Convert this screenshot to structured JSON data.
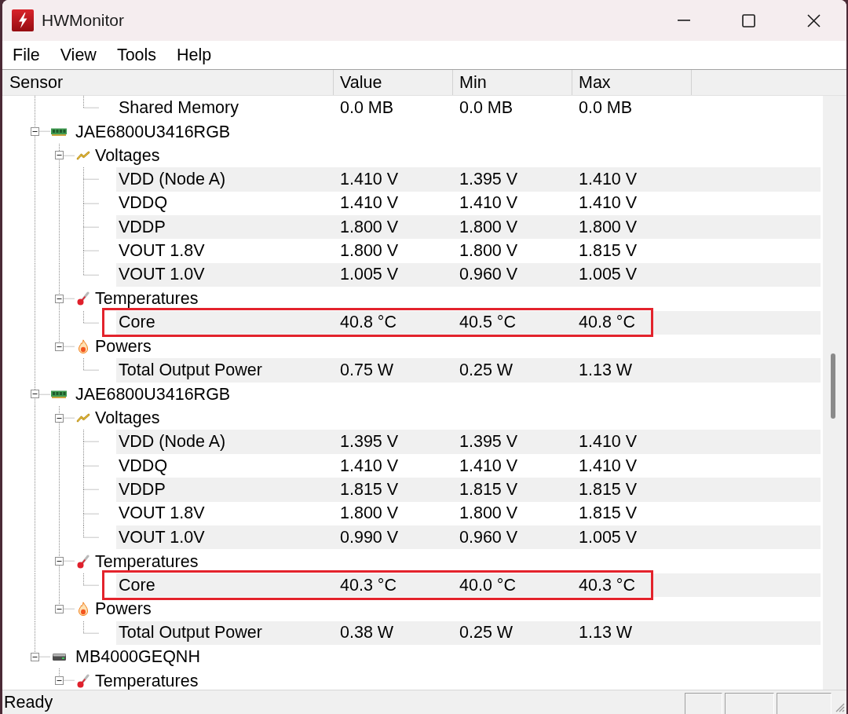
{
  "window": {
    "title": "HWMonitor"
  },
  "menu": [
    {
      "label": "File"
    },
    {
      "label": "View"
    },
    {
      "label": "Tools"
    },
    {
      "label": "Help"
    }
  ],
  "table": {
    "columns": [
      {
        "label": "Sensor"
      },
      {
        "label": "Value"
      },
      {
        "label": "Min"
      },
      {
        "label": "Max"
      }
    ],
    "tree": [
      {
        "children": [
          {
            "children": [
              {
                "label": "Shared Memory",
                "value": "0.0 MB",
                "min": "0.0 MB",
                "max": "0.0 MB",
                "shaded": false,
                "highlighted": false
              }
            ]
          }
        ]
      },
      {
        "kind": "memory",
        "label": "JAE6800U3416RGB",
        "expanded": true,
        "children": [
          {
            "kind": "voltages",
            "label": "Voltages",
            "expanded": true,
            "children": [
              {
                "label": "VDD (Node A)",
                "value": "1.410 V",
                "min": "1.395 V",
                "max": "1.410 V",
                "shaded": true,
                "highlighted": false
              },
              {
                "label": "VDDQ",
                "value": "1.410 V",
                "min": "1.410 V",
                "max": "1.410 V",
                "shaded": false,
                "highlighted": false
              },
              {
                "label": "VDDP",
                "value": "1.800 V",
                "min": "1.800 V",
                "max": "1.800 V",
                "shaded": true,
                "highlighted": false
              },
              {
                "label": "VOUT 1.8V",
                "value": "1.800 V",
                "min": "1.800 V",
                "max": "1.815 V",
                "shaded": false,
                "highlighted": false
              },
              {
                "label": "VOUT 1.0V",
                "value": "1.005 V",
                "min": "0.960 V",
                "max": "1.005 V",
                "shaded": true,
                "highlighted": false
              }
            ]
          },
          {
            "kind": "temperatures",
            "label": "Temperatures",
            "expanded": true,
            "children": [
              {
                "label": "Core",
                "value": "40.8 °C",
                "min": "40.5 °C",
                "max": "40.8 °C",
                "shaded": true,
                "highlighted": true
              }
            ]
          },
          {
            "kind": "powers",
            "label": "Powers",
            "expanded": true,
            "children": [
              {
                "label": "Total Output Power",
                "value": "0.75 W",
                "min": "0.25 W",
                "max": "1.13 W",
                "shaded": true,
                "highlighted": false
              }
            ]
          }
        ]
      },
      {
        "kind": "memory",
        "label": "JAE6800U3416RGB",
        "expanded": true,
        "children": [
          {
            "kind": "voltages",
            "label": "Voltages",
            "expanded": true,
            "children": [
              {
                "label": "VDD (Node A)",
                "value": "1.395 V",
                "min": "1.395 V",
                "max": "1.410 V",
                "shaded": true,
                "highlighted": false
              },
              {
                "label": "VDDQ",
                "value": "1.410 V",
                "min": "1.410 V",
                "max": "1.410 V",
                "shaded": false,
                "highlighted": false
              },
              {
                "label": "VDDP",
                "value": "1.815 V",
                "min": "1.815 V",
                "max": "1.815 V",
                "shaded": true,
                "highlighted": false
              },
              {
                "label": "VOUT 1.8V",
                "value": "1.800 V",
                "min": "1.800 V",
                "max": "1.815 V",
                "shaded": false,
                "highlighted": false
              },
              {
                "label": "VOUT 1.0V",
                "value": "0.990 V",
                "min": "0.960 V",
                "max": "1.005 V",
                "shaded": true,
                "highlighted": false
              }
            ]
          },
          {
            "kind": "temperatures",
            "label": "Temperatures",
            "expanded": true,
            "children": [
              {
                "label": "Core",
                "value": "40.3 °C",
                "min": "40.0 °C",
                "max": "40.3 °C",
                "shaded": true,
                "highlighted": true
              }
            ]
          },
          {
            "kind": "powers",
            "label": "Powers",
            "expanded": true,
            "children": [
              {
                "label": "Total Output Power",
                "value": "0.38 W",
                "min": "0.25 W",
                "max": "1.13 W",
                "shaded": true,
                "highlighted": false
              }
            ]
          }
        ]
      },
      {
        "kind": "drive",
        "label": "MB4000GEQNH",
        "expanded": true,
        "children": [
          {
            "kind": "temperatures",
            "label": "Temperatures",
            "expanded": true
          }
        ]
      }
    ]
  },
  "status_bar": {
    "text": "Ready"
  }
}
